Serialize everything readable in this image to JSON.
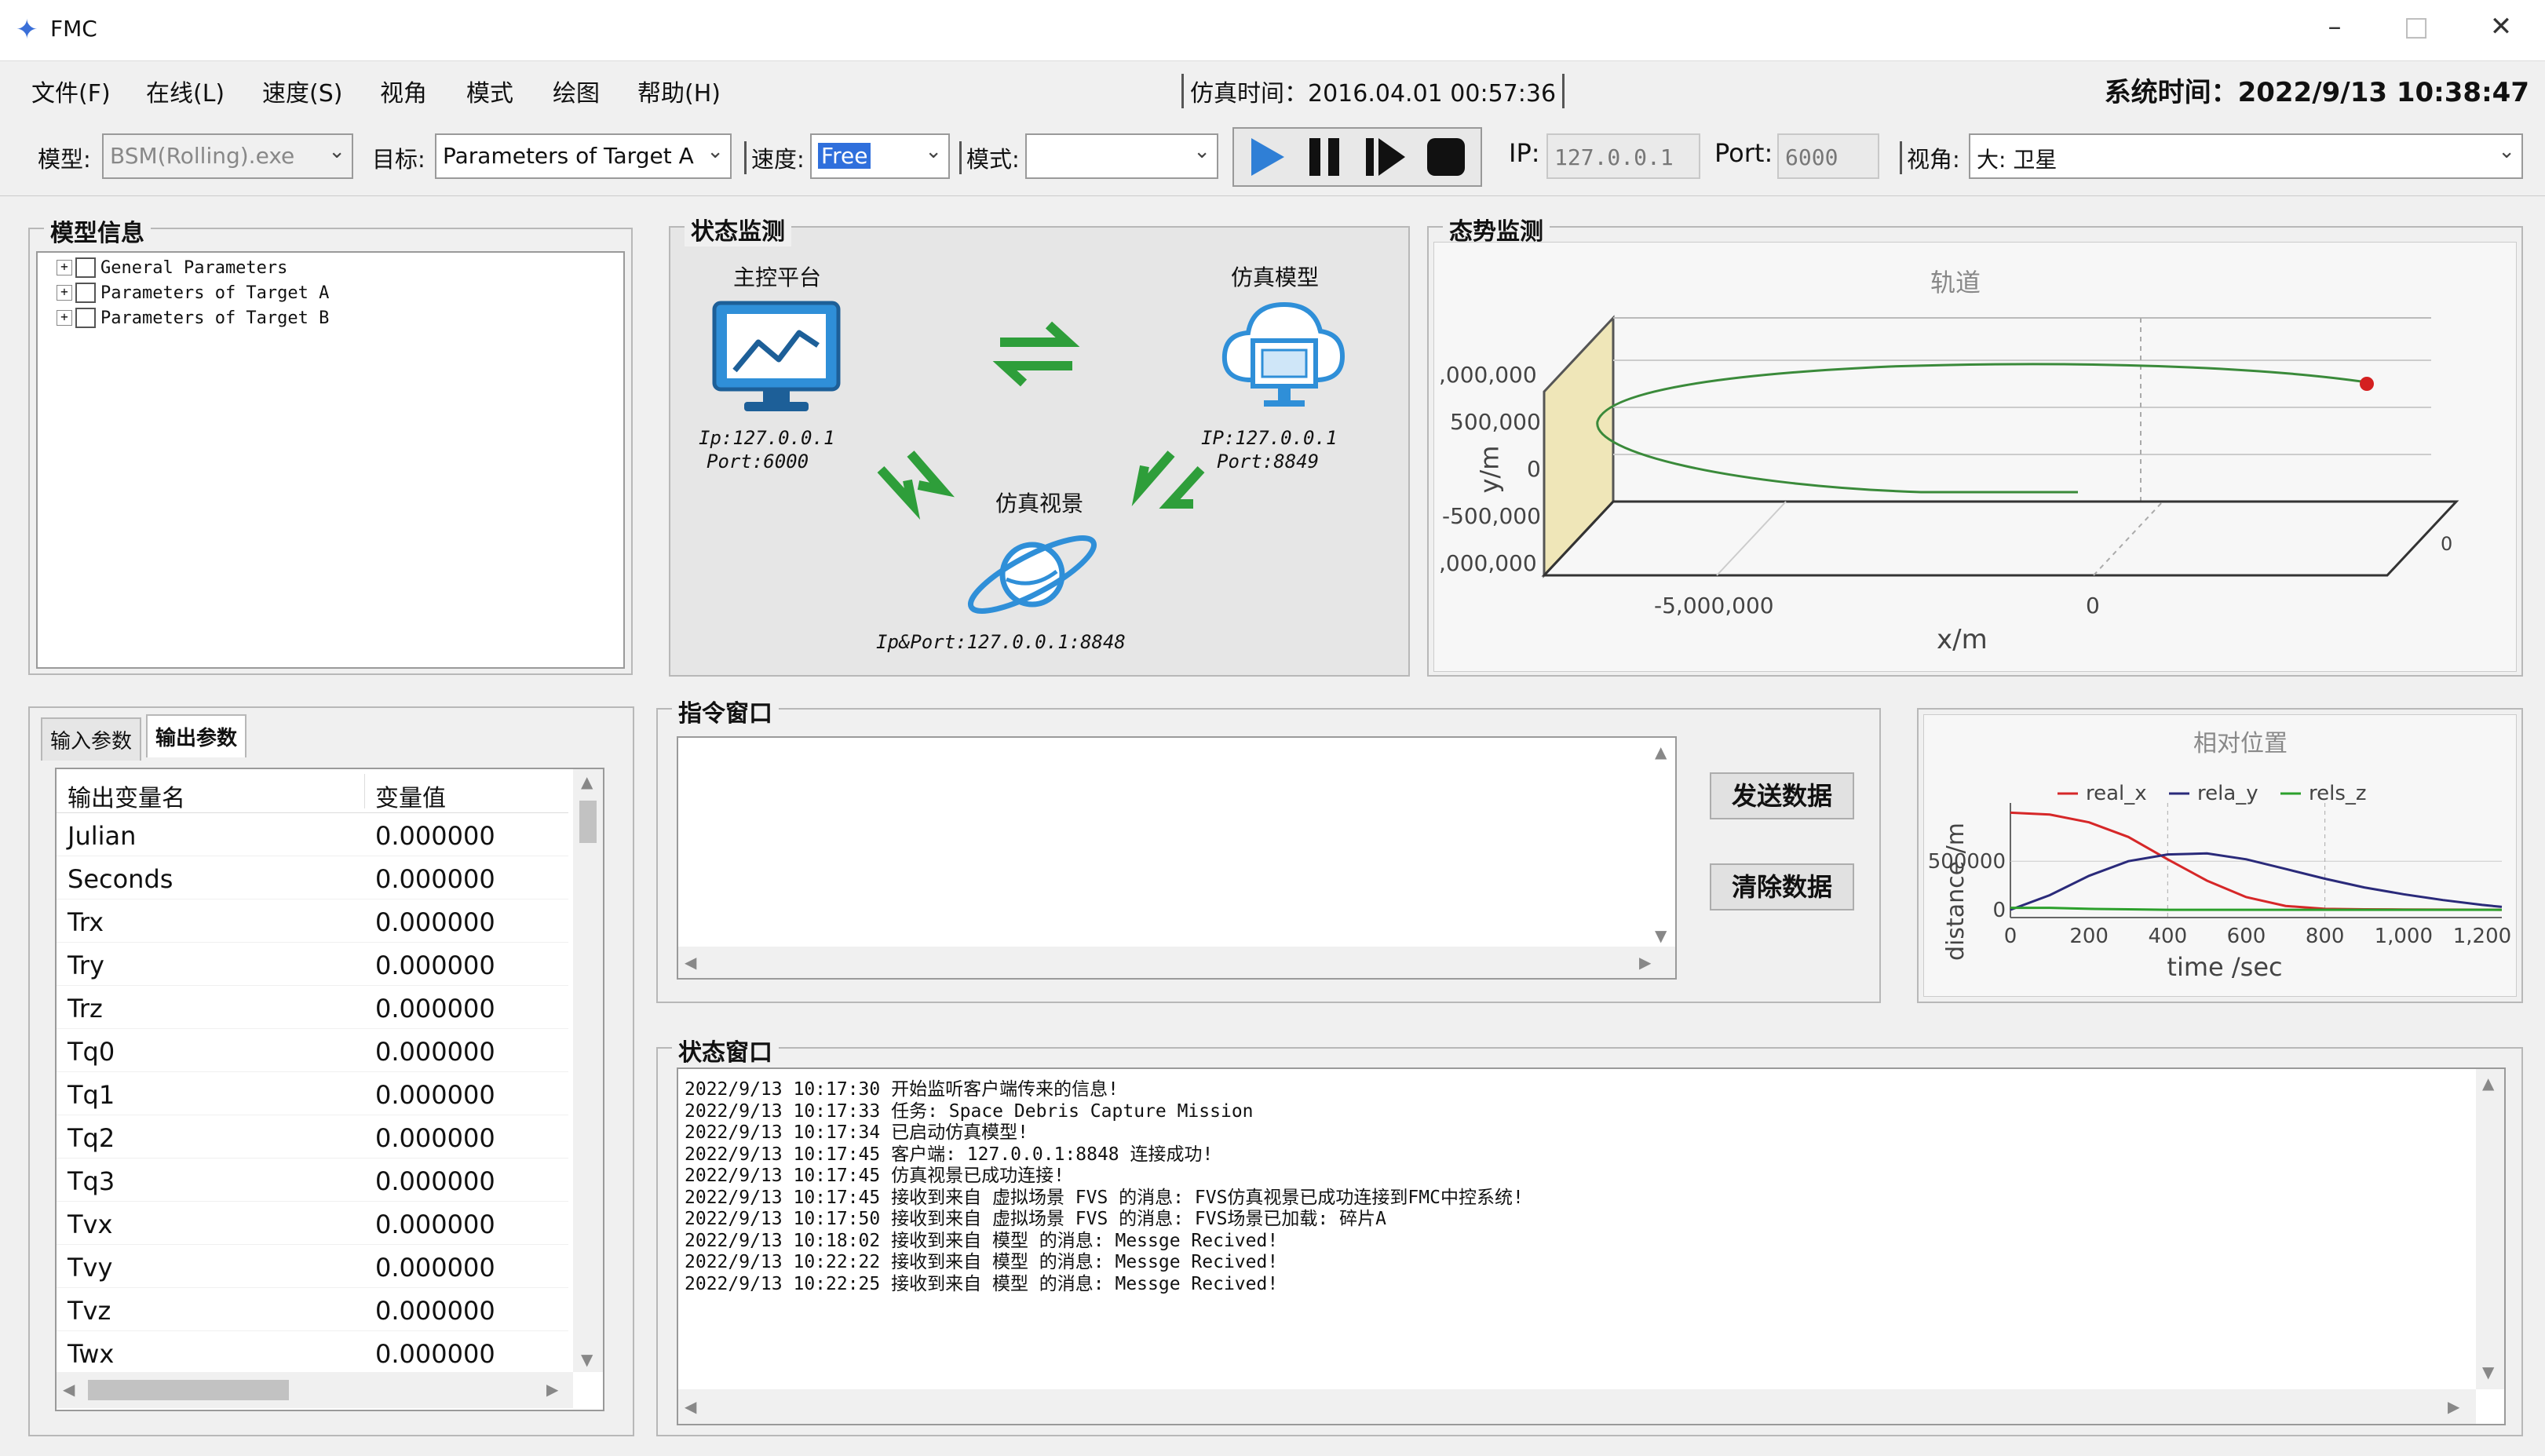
{
  "window": {
    "title": "FMC"
  },
  "menu": {
    "items": [
      "文件(F)",
      "在线(L)",
      "速度(S)",
      "视角",
      "模式",
      "绘图",
      "帮助(H)"
    ]
  },
  "header": {
    "sim_time": "仿真时间：2016.04.01 00:57:36",
    "sys_time": "系统时间：2022/9/13 10:38:47"
  },
  "toolbar": {
    "model_label": "模型:",
    "model_value": "BSM(Rolling).exe",
    "target_label": "目标:",
    "target_value": "Parameters of Target A",
    "speed_label": "速度:",
    "speed_value": "Free",
    "mode_label": "模式:",
    "mode_value": "",
    "ip_label": "IP:",
    "ip_value": "127.0.0.1",
    "port_label": "Port:",
    "port_value": "6000",
    "view_label": "视角:",
    "view_value": "大: 卫星"
  },
  "model_info": {
    "title": "模型信息",
    "tree": [
      "General Parameters",
      "Parameters of Target A",
      "Parameters of Target B"
    ]
  },
  "status_monitor": {
    "title": "状态监测",
    "main_platform": "主控平台",
    "main_ip": "Ip:127.0.0.1",
    "main_port": "Port:6000",
    "sim_model": "仿真模型",
    "model_ip": "IP:127.0.0.1",
    "model_port": "Port:8849",
    "sim_scene": "仿真视景",
    "scene_addr": "Ip&Port:127.0.0.1:8848"
  },
  "situation": {
    "title": "态势监测",
    "chart_title": "轨道",
    "ylabel": "y/m",
    "xlabel": "x/m",
    "y_ticks": [
      ",000,000",
      "500,000",
      "0",
      "-500,000",
      ",000,000"
    ],
    "x_ticks": [
      "-5,000,000",
      "0"
    ],
    "z_tick": "0"
  },
  "params": {
    "tabs": [
      "输入参数",
      "输出参数"
    ],
    "col_name": "输出变量名",
    "col_value": "变量值",
    "rows": [
      [
        "Julian",
        "0.000000"
      ],
      [
        "Seconds",
        "0.000000"
      ],
      [
        "Trx",
        "0.000000"
      ],
      [
        "Try",
        "0.000000"
      ],
      [
        "Trz",
        "0.000000"
      ],
      [
        "Tq0",
        "0.000000"
      ],
      [
        "Tq1",
        "0.000000"
      ],
      [
        "Tq2",
        "0.000000"
      ],
      [
        "Tq3",
        "0.000000"
      ],
      [
        "Tvx",
        "0.000000"
      ],
      [
        "Tvy",
        "0.000000"
      ],
      [
        "Tvz",
        "0.000000"
      ],
      [
        "Twx",
        "0.000000"
      ]
    ]
  },
  "command": {
    "title": "指令窗口",
    "send_label": "发送数据",
    "clear_label": "清除数据"
  },
  "status_window": {
    "title": "状态窗口",
    "lines": [
      "2022/9/13 10:17:30 开始监听客户端传来的信息!",
      "2022/9/13 10:17:33 任务: Space Debris Capture Mission",
      "2022/9/13 10:17:34 已启动仿真模型!",
      "2022/9/13 10:17:45 客户端: 127.0.0.1:8848 连接成功!",
      "2022/9/13 10:17:45 仿真视景已成功连接!",
      "2022/9/13 10:17:45 接收到来自 虚拟场景 FVS  的消息:  FVS仿真视景已成功连接到FMC中控系统!",
      "2022/9/13 10:17:50 接收到来自 虚拟场景 FVS  的消息:  FVS场景已加载: 碎片A",
      "2022/9/13 10:18:02 接收到来自 模型 的消息: Messge Recived!",
      "2022/9/13 10:22:22 接收到来自 模型 的消息: Messge Recived!",
      "2022/9/13 10:22:25 接收到来自 模型 的消息: Messge Recived!"
    ]
  },
  "chart_data": {
    "type": "line",
    "title": "相对位置",
    "xlabel": "time /sec",
    "ylabel": "distance /m",
    "x_ticks": [
      "0",
      "200",
      "400",
      "600",
      "800",
      "1,000",
      "1,200"
    ],
    "y_ticks": [
      "500000",
      "0"
    ],
    "xlim": [
      0,
      1250
    ],
    "ylim": [
      -80000,
      1100000
    ],
    "x": [
      0,
      100,
      200,
      300,
      400,
      500,
      600,
      700,
      800,
      900,
      1000,
      1100,
      1200,
      1250
    ],
    "series": [
      {
        "name": "real_x",
        "color": "#d62728",
        "values": [
          1000000,
          980000,
          900000,
          750000,
          520000,
          300000,
          130000,
          40000,
          10000,
          5000,
          3000,
          2000,
          1000,
          0
        ]
      },
      {
        "name": "rela_y",
        "color": "#2a2a7a",
        "values": [
          0,
          150000,
          350000,
          500000,
          570000,
          580000,
          520000,
          420000,
          320000,
          230000,
          160000,
          100000,
          50000,
          30000
        ]
      },
      {
        "name": "rels_z",
        "color": "#2ca02c",
        "values": [
          20000,
          20000,
          10000,
          5000,
          0,
          0,
          0,
          0,
          0,
          0,
          0,
          0,
          0,
          0
        ]
      }
    ]
  }
}
